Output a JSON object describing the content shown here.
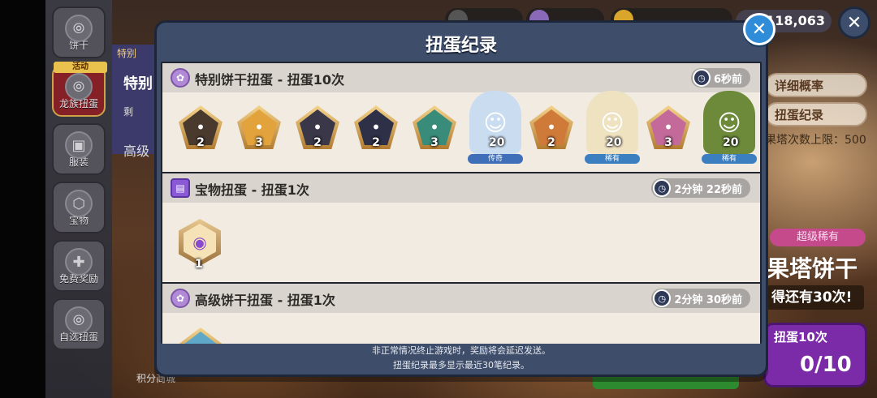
{
  "modal": {
    "title": "扭蛋纪录",
    "footer_line1": "非正常情况终止游戏时，奖励将会延迟发送。",
    "footer_line2": "扭蛋纪录最多显示最近30笔纪录。"
  },
  "sidebar": {
    "items": [
      {
        "label": "饼干",
        "icon": "cookie-icon"
      },
      {
        "label": "龙族扭蛋",
        "icon": "gacha-icon",
        "tag": "活动"
      },
      {
        "label": "服装",
        "icon": "shirt-icon"
      },
      {
        "label": "宝物",
        "icon": "treasure-icon"
      },
      {
        "label": "免费奖励",
        "icon": "gift-icon"
      },
      {
        "label": "自选扭蛋",
        "icon": "gacha-select-icon"
      }
    ]
  },
  "background": {
    "panel_tab": "特别",
    "panel_title": "特别",
    "panel_sub": "剩",
    "panel_other": "高级",
    "currency_gems": "118,063",
    "detail_prob": "详细概率",
    "gacha_record": "扭蛋纪录",
    "tower_limit": "果塔次数上限：500",
    "rarity_badge": "超级稀有",
    "cookie_name": "果塔饼干",
    "remaining": "得还有30次!",
    "pull_label": "扭蛋10次",
    "pull_progress": "0/10",
    "points_shop": "积分商城"
  },
  "records": [
    {
      "title": "特别饼干扭蛋 - 扭蛋10次",
      "time": "6秒前",
      "items": [
        {
          "type": "soulstone",
          "count": "2",
          "color": "#4a3a2e",
          "icon": "cookie-soulstone-icon"
        },
        {
          "type": "soulstone",
          "count": "3",
          "color": "#e2a23c",
          "icon": "cookie-soulstone-icon"
        },
        {
          "type": "soulstone",
          "count": "2",
          "color": "#3a3848",
          "icon": "cookie-soulstone-icon"
        },
        {
          "type": "soulstone",
          "count": "2",
          "color": "#2e3048",
          "icon": "cookie-soulstone-icon"
        },
        {
          "type": "soulstone",
          "count": "3",
          "color": "#3a8c7a",
          "icon": "cookie-soulstone-icon"
        },
        {
          "type": "cookie",
          "count": "20",
          "rarity": "传奇",
          "color": "#c9dcf0",
          "rarity_color": "#3f6fb8",
          "icon": "legendary-cookie-icon"
        },
        {
          "type": "soulstone",
          "count": "2",
          "color": "#d07a3a",
          "icon": "cookie-soulstone-icon"
        },
        {
          "type": "cookie",
          "count": "20",
          "rarity": "稀有",
          "color": "#efe2c0",
          "rarity_color": "#3b7fc0",
          "icon": "rare-cookie-icon"
        },
        {
          "type": "soulstone",
          "count": "3",
          "color": "#c46a9a",
          "icon": "cookie-soulstone-icon"
        },
        {
          "type": "cookie",
          "count": "20",
          "rarity": "稀有",
          "color": "#6c8a3a",
          "rarity_color": "#3b7fc0",
          "icon": "rare-cookie-icon"
        }
      ]
    },
    {
      "title": "宝物扭蛋 - 扭蛋1次",
      "time": "2分钟 22秒前",
      "items": [
        {
          "type": "treasure",
          "count": "1",
          "icon": "treasure-item-icon"
        }
      ]
    },
    {
      "title": "高级饼干扭蛋 - 扭蛋1次",
      "time": "2分钟 30秒前",
      "items": []
    }
  ]
}
